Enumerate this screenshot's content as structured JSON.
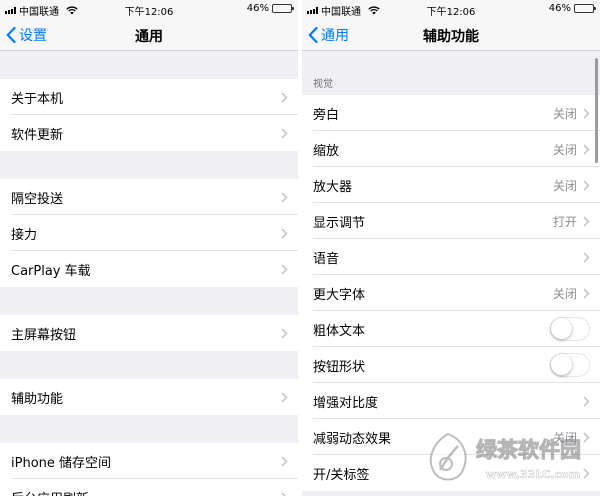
{
  "left": {
    "status_bar": {
      "carrier": "中国联通",
      "time": "下午12:06",
      "battery_percent": 46
    },
    "nav": {
      "back_label": "设置",
      "title": "通用"
    },
    "groups": [
      {
        "items": [
          {
            "label": "关于本机"
          },
          {
            "label": "软件更新"
          }
        ]
      },
      {
        "items": [
          {
            "label": "隔空投送"
          },
          {
            "label": "接力"
          },
          {
            "label": "CarPlay 车载"
          }
        ]
      },
      {
        "items": [
          {
            "label": "主屏幕按钮"
          }
        ]
      },
      {
        "items": [
          {
            "label": "辅助功能"
          }
        ]
      },
      {
        "items": [
          {
            "label": "iPhone 储存空间"
          },
          {
            "label": "后台应用刷新"
          }
        ]
      }
    ]
  },
  "right": {
    "status_bar": {
      "carrier": "中国联通",
      "time": "下午12:06",
      "battery_percent": 46
    },
    "nav": {
      "back_label": "通用",
      "title": "辅助功能"
    },
    "section_label": "视觉",
    "items": [
      {
        "label": "旁白",
        "value": "关闭",
        "accessory": "chevron"
      },
      {
        "label": "缩放",
        "value": "关闭",
        "accessory": "chevron"
      },
      {
        "label": "放大器",
        "value": "关闭",
        "accessory": "chevron"
      },
      {
        "label": "显示调节",
        "value": "打开",
        "accessory": "chevron"
      },
      {
        "label": "语音",
        "value": "",
        "accessory": "chevron"
      },
      {
        "label": "更大字体",
        "value": "关闭",
        "accessory": "chevron"
      },
      {
        "label": "粗体文本",
        "value": "",
        "accessory": "switch",
        "on": false
      },
      {
        "label": "按钮形状",
        "value": "",
        "accessory": "switch",
        "on": false
      },
      {
        "label": "增强对比度",
        "value": "",
        "accessory": "chevron"
      },
      {
        "label": "减弱动态效果",
        "value": "关闭",
        "accessory": "chevron"
      },
      {
        "label": "开/关标签",
        "value": "",
        "accessory": "chevron"
      }
    ]
  },
  "watermark": {
    "brand": "绿茶软件园",
    "url": "www.33LC.com"
  },
  "colors": {
    "accent": "#007aff",
    "background": "#efeff4",
    "secondary_text": "#8e8e93",
    "chevron": "#c7c7cc"
  },
  "icons": {
    "back": "chevron-left-icon",
    "disclosure": "chevron-right-icon",
    "wifi": "wifi-icon",
    "signal": "signal-icon",
    "battery": "battery-icon"
  }
}
